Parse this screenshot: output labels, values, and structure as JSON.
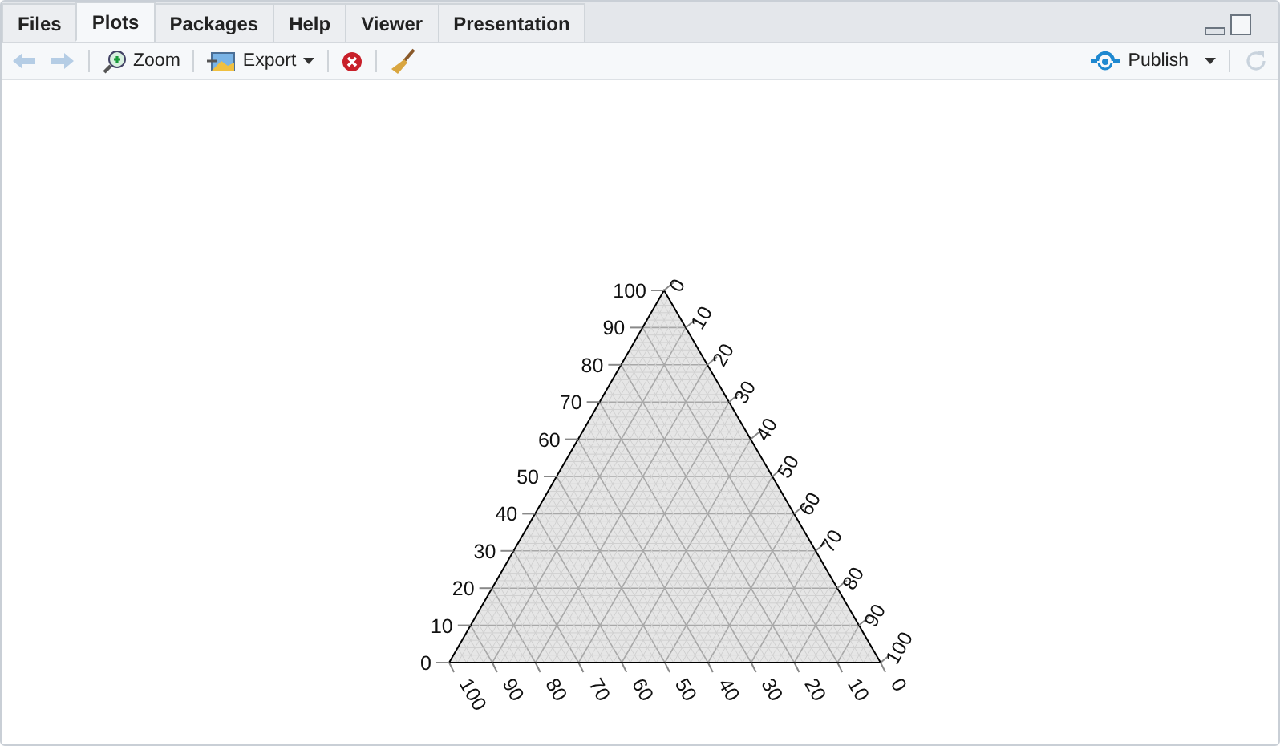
{
  "tabs": [
    {
      "label": "Files",
      "selected": false
    },
    {
      "label": "Plots",
      "selected": true
    },
    {
      "label": "Packages",
      "selected": false
    },
    {
      "label": "Help",
      "selected": false
    },
    {
      "label": "Viewer",
      "selected": false
    },
    {
      "label": "Presentation",
      "selected": false
    }
  ],
  "toolbar": {
    "back": {
      "disabled": true
    },
    "forward": {
      "disabled": true
    },
    "zoom": {
      "label": "Zoom"
    },
    "export": {
      "label": "Export"
    },
    "publish": {
      "label": "Publish"
    },
    "refresh": {
      "disabled": true
    }
  },
  "plot": {
    "left_axis": [
      "0",
      "10",
      "20",
      "30",
      "40",
      "50",
      "60",
      "70",
      "80",
      "90",
      "100"
    ],
    "right_axis": [
      "0",
      "10",
      "20",
      "30",
      "40",
      "50",
      "60",
      "70",
      "80",
      "90",
      "100"
    ],
    "bottom_axis": [
      "100",
      "90",
      "80",
      "70",
      "60",
      "50",
      "40",
      "30",
      "20",
      "10",
      "0"
    ]
  }
}
